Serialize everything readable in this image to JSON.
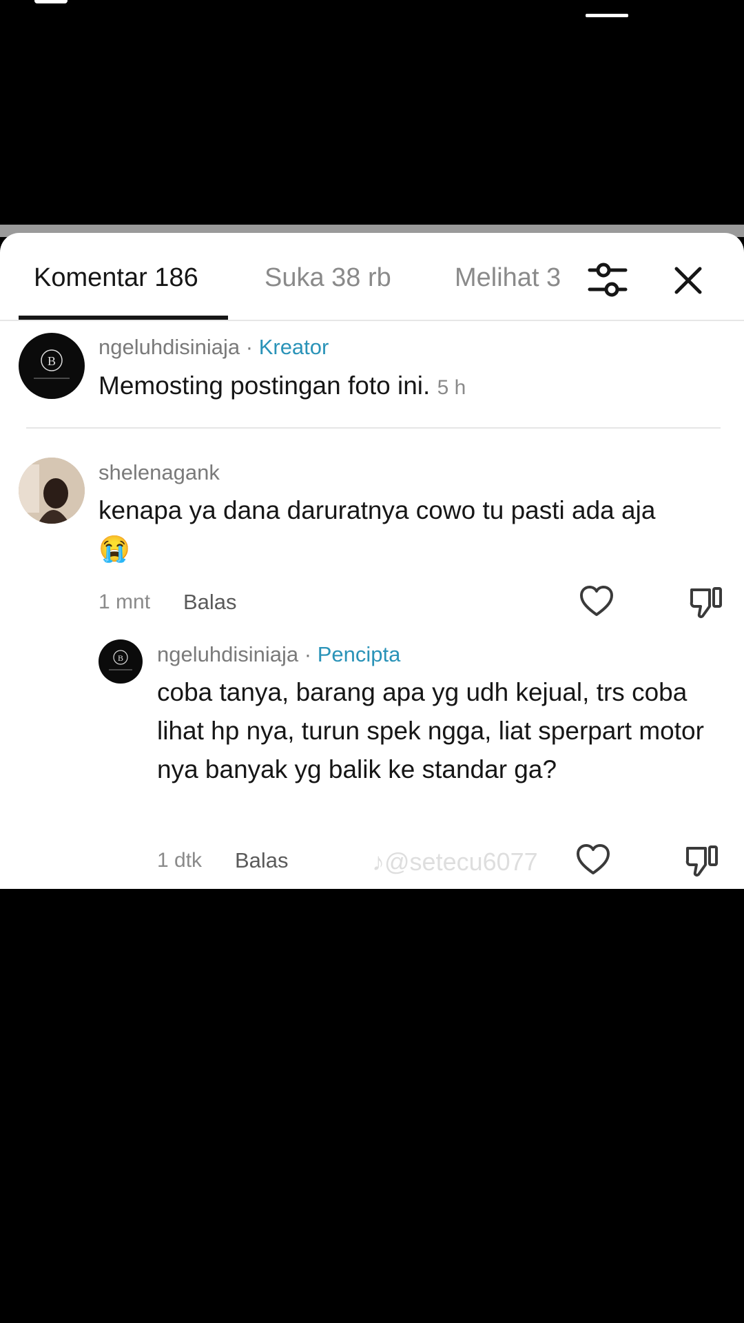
{
  "tabs": [
    {
      "label": "Komentar 186"
    },
    {
      "label": "Suka 38 rb"
    },
    {
      "label": "Melihat 3"
    }
  ],
  "comments": [
    {
      "username": "ngeluhdisiniaja",
      "badge": "Kreator",
      "separator": "·",
      "text": "Memosting postingan foto ini.",
      "time": "5 h"
    },
    {
      "username": "shelenagank",
      "text": "kenapa ya dana daruratnya cowo tu pasti ada aja",
      "emoji": "😭",
      "time": "1 mnt",
      "reply_label": "Balas"
    },
    {
      "username": "ngeluhdisiniaja",
      "badge": "Pencipta",
      "separator": "·",
      "text": "coba tanya, barang apa yg udh kejual, trs coba lihat hp nya, turun spek ngga, liat sperpart motor nya banyak yg balik ke standar ga?",
      "time": "1 dtk",
      "reply_label": "Balas"
    }
  ],
  "watermark": "@setecu6077",
  "icons": {
    "filter": "sliders-icon",
    "close": "close-icon",
    "like": "heart-icon",
    "dislike": "thumbs-down-icon"
  },
  "colors": {
    "badge": "#2a93b8",
    "text": "#161616",
    "muted": "#8a8a8a"
  }
}
